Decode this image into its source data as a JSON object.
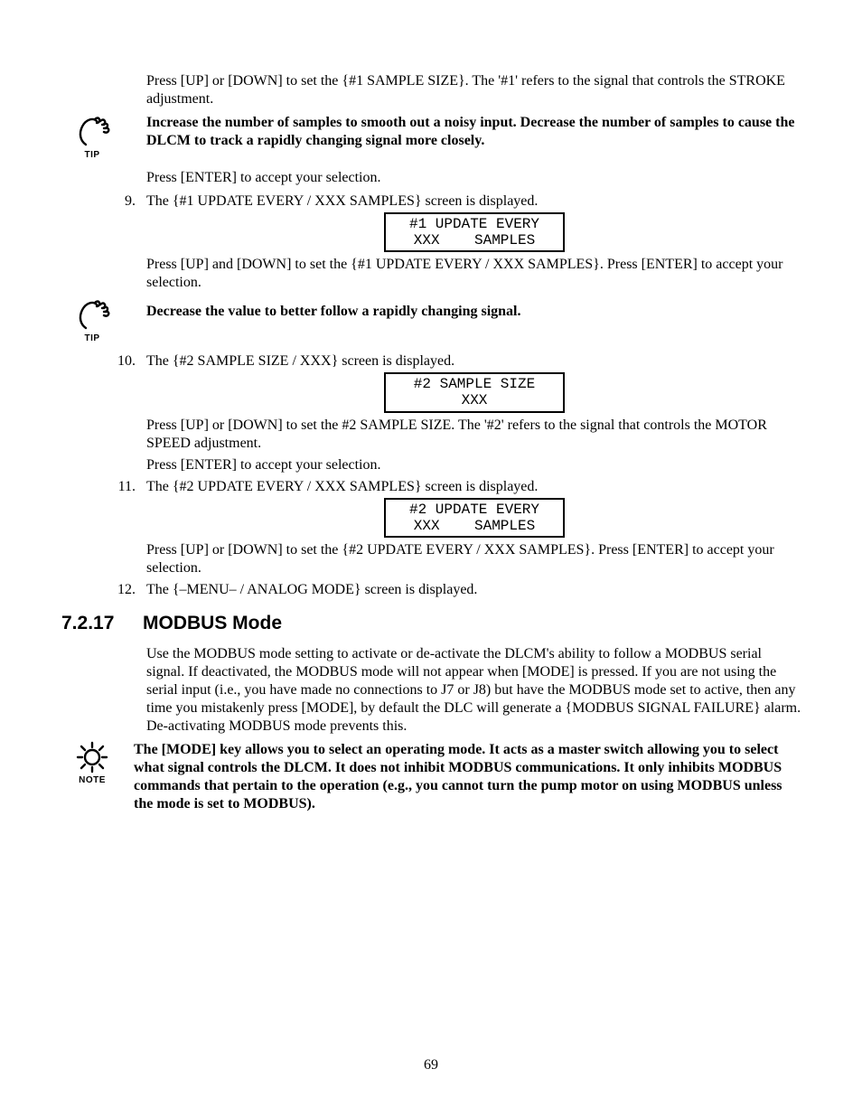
{
  "p_intro": "Press [UP] or [DOWN] to set the {#1 SAMPLE SIZE}.  The '#1' refers to the signal that controls the STROKE adjustment.",
  "tip1": "Increase the number of samples to smooth out a noisy input.  Decrease the number of samples to cause the DLCM to track a rapidly changing signal more closely.",
  "p_enter1": "Press [ENTER] to accept your selection.",
  "step9": {
    "num": "9.",
    "a": "The {#1 UPDATE EVERY / XXX SAMPLES} screen is displayed.",
    "lcd1": "#1 UPDATE EVERY",
    "lcd2": "XXX    SAMPLES",
    "b": "Press [UP] and [DOWN] to set the {#1 UPDATE EVERY / XXX  SAMPLES}.  Press [ENTER] to accept your selection."
  },
  "tip2": "Decrease the value to better  follow a rapidly changing signal.",
  "step10": {
    "num": "10.",
    "a": "The {#2 SAMPLE SIZE / XXX} screen is displayed.",
    "lcd1": "#2 SAMPLE SIZE",
    "lcd2": "XXX",
    "b": "Press [UP] or [DOWN] to set the #2 SAMPLE SIZE.  The '#2' refers to the signal that controls the MOTOR SPEED adjustment.",
    "c": "Press [ENTER] to accept your selection."
  },
  "step11": {
    "num": "11.",
    "a": "The {#2 UPDATE EVERY / XXX SAMPLES} screen is displayed.",
    "lcd1": "#2 UPDATE EVERY",
    "lcd2": "XXX    SAMPLES",
    "b": "Press [UP] or [DOWN] to set the {#2 UPDATE EVERY / XXX SAMPLES}.  Press [ENTER] to accept your selection."
  },
  "step12": {
    "num": "12.",
    "a": "The {–MENU– / ANALOG MODE} screen is displayed."
  },
  "section": {
    "num": "7.2.17",
    "title": "MODBUS Mode"
  },
  "sec_para": "Use the MODBUS mode setting to activate or de-activate the DLCM's ability to follow a MODBUS serial signal.  If deactivated, the MODBUS mode will not appear when [MODE] is pressed.  If you are not using the serial input (i.e., you have made no connections to J7 or J8) but have the MODBUS mode set to active, then any time you mistakenly press [MODE], by default the DLC will generate a {MODBUS SIGNAL FAILURE} alarm.  De-activating MODBUS mode prevents this.",
  "note": "The [MODE] key allows you to select an operating mode.  It acts as a master switch allowing you to select what signal controls the DLCM.  It does not inhibit MODBUS communications.  It only inhibits MODBUS commands that pertain to the operation (e.g., you cannot turn the pump motor on using MODBUS unless the mode is set to MODBUS).",
  "labels": {
    "tip": "TIP",
    "note": "NOTE"
  },
  "pagenum": "69"
}
